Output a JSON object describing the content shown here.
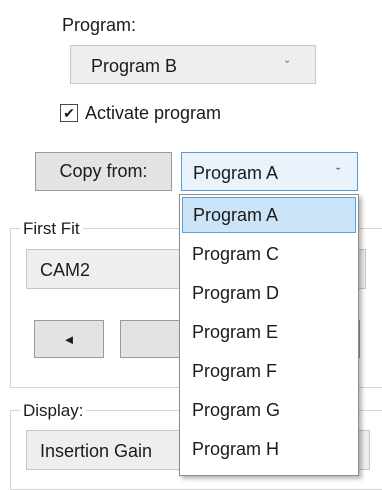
{
  "program_label": "Program:",
  "program_select": {
    "value": "Program B",
    "chevron_icon": "chevron-down-icon"
  },
  "activate": {
    "label": "Activate program",
    "checked": true,
    "check_glyph": "✔"
  },
  "copy_from": {
    "button_label": "Copy from:",
    "selected": "Program A",
    "options": [
      "Program A",
      "Program C",
      "Program D",
      "Program E",
      "Program F",
      "Program G",
      "Program H"
    ],
    "highlighted_index": 0
  },
  "first_fit": {
    "title": "First Fit",
    "field_value": "CAM2",
    "left_arrow_glyph": "◄"
  },
  "display": {
    "title": "Display:",
    "field_value": "Insertion Gain"
  }
}
